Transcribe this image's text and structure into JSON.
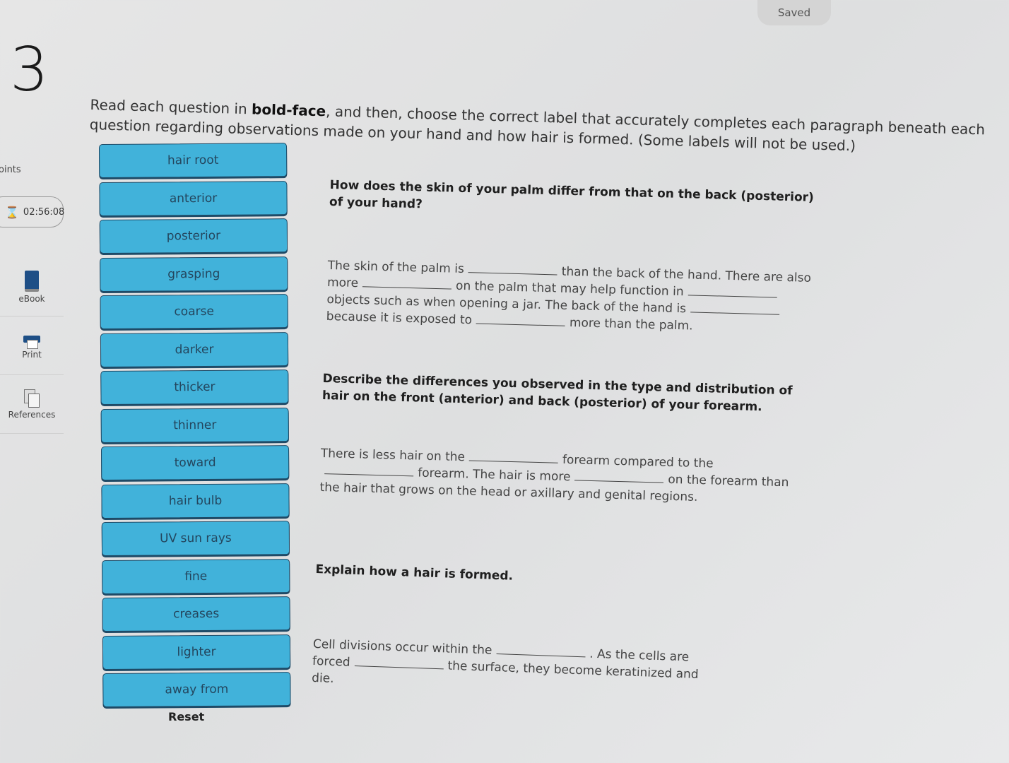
{
  "status": {
    "saved_label": "Saved"
  },
  "question": {
    "number": "3",
    "points_label": "oints",
    "timer": "02:56:08"
  },
  "side_tools": [
    {
      "label": "eBook",
      "icon": "ebook-icon"
    },
    {
      "label": "Print",
      "icon": "print-icon"
    },
    {
      "label": "References",
      "icon": "references-icon"
    }
  ],
  "instructions": {
    "part1": "Read each question in ",
    "bold": "bold-face",
    "part2": ", and then, choose the correct label that accurately completes each paragraph beneath each question regarding observations made on your hand and how hair is formed. (Some labels will not be used.)"
  },
  "labels": [
    "hair root",
    "anterior",
    "posterior",
    "grasping",
    "coarse",
    "darker",
    "thicker",
    "thinner",
    "toward",
    "hair bulb",
    "UV sun rays",
    "fine",
    "creases",
    "lighter",
    "away from"
  ],
  "reset_label": "Reset",
  "sections": [
    {
      "question": "How does the skin of your palm differ from that on the back (posterior) of your hand?",
      "segments": [
        "The skin of the palm is",
        "than the back of the hand. There are also more",
        "on the palm that may help function in",
        "objects such as when opening a jar. The back of the hand is",
        "because it is exposed to",
        "more than the palm."
      ]
    },
    {
      "question": "Describe the differences you observed in the type and distribution of hair on the front (anterior) and back (posterior) of your forearm.",
      "segments": [
        "There is less hair on the",
        "forearm compared to the",
        "forearm. The hair is more",
        "on the forearm than the hair that grows on the head or axillary and genital regions."
      ]
    },
    {
      "question": "Explain how a hair is formed.",
      "segments": [
        "Cell divisions occur within the",
        ". As the cells are forced",
        "the surface, they become keratinized and die."
      ]
    }
  ]
}
